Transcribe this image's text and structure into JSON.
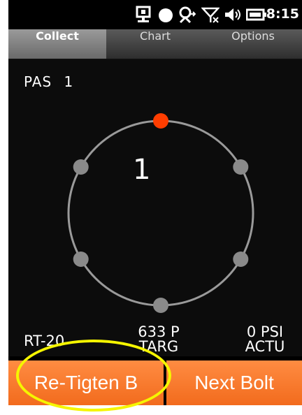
{
  "status_bar": {
    "time": "8:15",
    "icons": [
      "sync-icon",
      "record-icon",
      "connectivity-icon",
      "no-signal-icon",
      "volume-icon",
      "battery-icon"
    ]
  },
  "tabs": [
    {
      "label": "Collect",
      "active": true
    },
    {
      "label": "Chart",
      "active": false
    },
    {
      "label": "Options",
      "active": false
    }
  ],
  "pass": {
    "label": "PAS",
    "number": "1"
  },
  "bolt_pattern": {
    "current_bolt": "1",
    "bolt_count": 6,
    "active_index": 0,
    "active_color": "#ff3d00",
    "inactive_color": "#8a8a8a",
    "ring_color": "#9a9a9a"
  },
  "readouts": {
    "tool": "RT-20",
    "target_value": "633 P",
    "target_label": "TARG",
    "actual_value": "0 PSI",
    "actual_label": "ACTU"
  },
  "buttons": {
    "retighten": "Re-Tigten B",
    "next_bolt": "Next Bolt"
  },
  "colors": {
    "accent": "#f26b1d",
    "highlight": "#f5f500"
  }
}
